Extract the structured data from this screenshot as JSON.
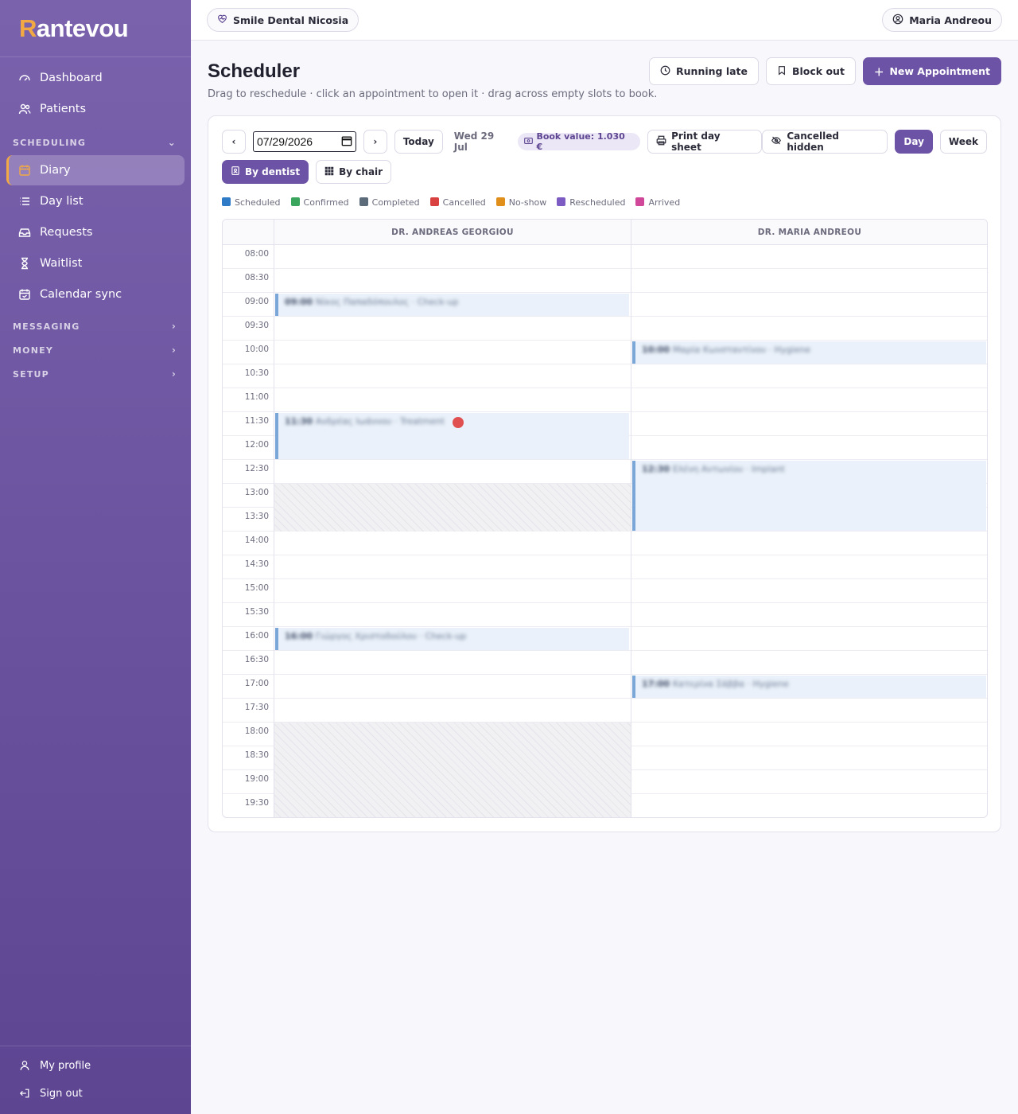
{
  "brand": {
    "logo_r": "R",
    "logo_rest": "antevou",
    "accent": "#f2a944",
    "sidebar_color": "#6d53a5"
  },
  "sidebar": {
    "top_items": [
      {
        "label": "Dashboard",
        "icon": "gauge-icon"
      },
      {
        "label": "Patients",
        "icon": "users-icon"
      }
    ],
    "scheduling_label": "SCHEDULING",
    "scheduling_items": [
      {
        "label": "Diary",
        "icon": "calendar-icon",
        "active": true
      },
      {
        "label": "Day list",
        "icon": "list-icon"
      },
      {
        "label": "Requests",
        "icon": "inbox-icon"
      },
      {
        "label": "Waitlist",
        "icon": "hourglass-icon"
      },
      {
        "label": "Calendar sync",
        "icon": "calendar-check-icon"
      }
    ],
    "sections": [
      "MESSAGING",
      "MONEY",
      "SETUP"
    ],
    "bottom_items": [
      {
        "label": "My profile",
        "icon": "user-icon"
      },
      {
        "label": "Sign out",
        "icon": "sign-out-icon"
      }
    ]
  },
  "topbar": {
    "clinic": "Smile Dental Nicosia",
    "user": "Maria Andreou"
  },
  "header": {
    "title": "Scheduler",
    "subtitle": "Drag to reschedule · click an appointment to open it · drag across empty slots to book.",
    "running_late": "Running late",
    "block_out": "Block out",
    "new_appointment": "New Appointment"
  },
  "toolbar": {
    "date_value": "07/29/2026",
    "today": "Today",
    "day_label": "Wed 29 Jul",
    "book_value": "Book value: 1.030 €",
    "print": "Print day sheet",
    "cancelled": "Cancelled hidden",
    "day": "Day",
    "week": "Week",
    "by_dentist": "By dentist",
    "by_chair": "By chair"
  },
  "legend": [
    {
      "label": "Scheduled",
      "color": "#2f7bc8"
    },
    {
      "label": "Confirmed",
      "color": "#3aa55c"
    },
    {
      "label": "Completed",
      "color": "#5c6b7a"
    },
    {
      "label": "Cancelled",
      "color": "#d94141"
    },
    {
      "label": "No-show",
      "color": "#e0901a"
    },
    {
      "label": "Rescheduled",
      "color": "#7c5cc2"
    },
    {
      "label": "Arrived",
      "color": "#d0479a"
    }
  ],
  "columns": [
    "DR. ANDREAS GEORGIOU",
    "DR. MARIA ANDREOU"
  ],
  "times": [
    "08:00",
    "08:30",
    "09:00",
    "09:30",
    "10:00",
    "10:30",
    "11:00",
    "11:30",
    "12:00",
    "12:30",
    "13:00",
    "13:30",
    "14:00",
    "14:30",
    "15:00",
    "15:30",
    "16:00",
    "16:30",
    "17:00",
    "17:30",
    "18:00",
    "18:30",
    "19:00",
    "19:30"
  ],
  "appointments": [
    {
      "col": 0,
      "start": "09:00",
      "end": "09:30",
      "time": "09:00",
      "name": "Νίκος Παπαδόπουλος",
      "type": "Check-up"
    },
    {
      "col": 0,
      "start": "11:30",
      "end": "12:30",
      "time": "11:30",
      "name": "Ανδρέας Ιωάννου",
      "type": "Treatment",
      "flag": true
    },
    {
      "col": 0,
      "start": "16:00",
      "end": "16:30",
      "time": "16:00",
      "name": "Γιώργος Χριστοδούλου",
      "type": "Check-up"
    },
    {
      "col": 1,
      "start": "10:00",
      "end": "10:30",
      "time": "10:00",
      "name": "Μαρία Κωνσταντίνου",
      "type": "Hygiene"
    },
    {
      "col": 1,
      "start": "12:30",
      "end": "14:00",
      "time": "12:30",
      "name": "Ελένη Αντωνίου",
      "type": "Implant"
    },
    {
      "col": 1,
      "start": "17:00",
      "end": "17:30",
      "time": "17:00",
      "name": "Κατερίνα Σάββα",
      "type": "Hygiene"
    }
  ],
  "blocked": [
    {
      "col": 0,
      "start": "13:00",
      "end": "14:00"
    },
    {
      "col": 0,
      "start": "18:00",
      "end": "20:00"
    }
  ]
}
